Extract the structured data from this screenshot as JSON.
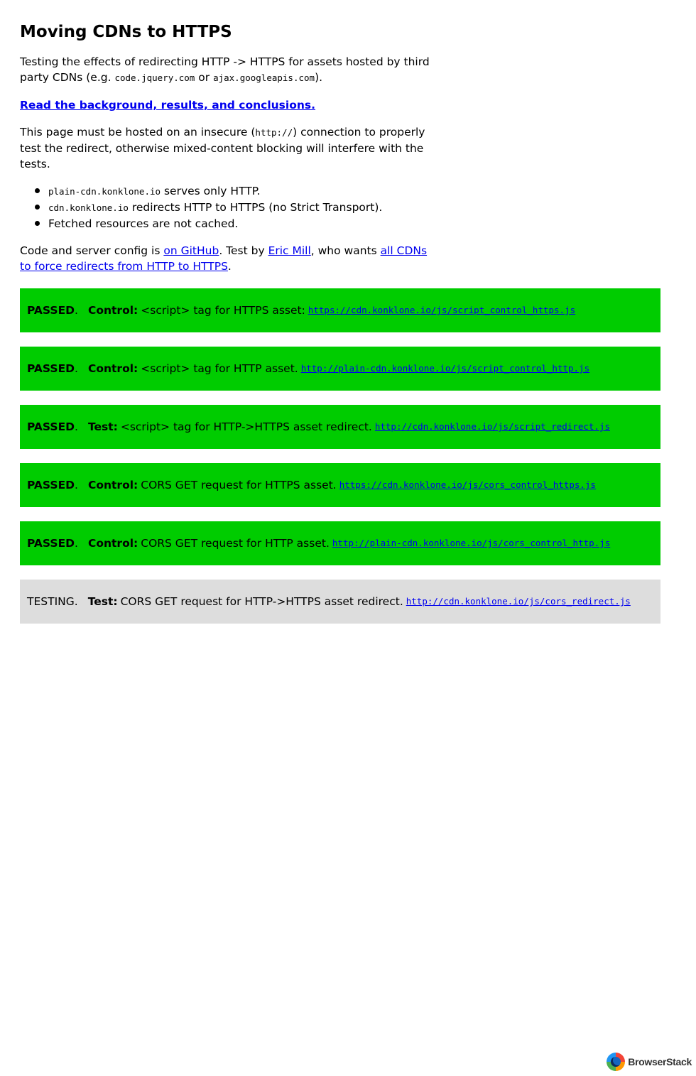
{
  "page": {
    "title": "Moving CDNs to HTTPS",
    "intro": {
      "text1": "Testing the effects of redirecting HTTP -> HTTPS for assets hosted by third party CDNs (e.g. ",
      "code1": "code.jquery.com",
      "text2": " or ",
      "code2": "ajax.googleapis.com",
      "text3": ")."
    },
    "background_link": "Read the background, results, and conclusions.",
    "insecure": {
      "text1": "This page must be hosted on an insecure (",
      "code": "http://",
      "text2": ") connection to properly test the redirect, otherwise mixed-content blocking will interfere with the tests."
    },
    "notes": [
      {
        "code": "plain-cdn.konklone.io",
        "text": " serves only HTTP."
      },
      {
        "code": "cdn.konklone.io",
        "text": " redirects HTTP to HTTPS (no Strict Transport)."
      },
      {
        "code": "",
        "text": "Fetched resources are not cached."
      }
    ],
    "credits": {
      "text1": "Code and server config is ",
      "github_link": "on GitHub",
      "text2": ". Test by ",
      "author_link": "Eric Mill",
      "text3": ", who wants ",
      "cause_link": "all CDNs to force redirects from HTTP to HTTPS",
      "text4": "."
    }
  },
  "tests": [
    {
      "status": "PASSED",
      "kind": "Control:",
      "description": "<script> tag for HTTPS asset:",
      "url": "https://cdn.konklone.io/js/script_control_https.js"
    },
    {
      "status": "PASSED",
      "kind": "Control:",
      "description": "<script> tag for HTTP asset.",
      "url": "http://plain-cdn.konklone.io/js/script_control_http.js"
    },
    {
      "status": "PASSED",
      "kind": "Test:",
      "description": "<script> tag for HTTP->HTTPS asset redirect.",
      "url": "http://cdn.konklone.io/js/script_redirect.js"
    },
    {
      "status": "PASSED",
      "kind": "Control:",
      "description": "CORS GET request for HTTPS asset.",
      "url": "https://cdn.konklone.io/js/cors_control_https.js"
    },
    {
      "status": "PASSED",
      "kind": "Control:",
      "description": "CORS GET request for HTTP asset.",
      "url": "http://plain-cdn.konklone.io/js/cors_control_http.js"
    },
    {
      "status": "TESTING",
      "kind": "Test:",
      "description": "CORS GET request for HTTP->HTTPS asset redirect.",
      "url": "http://cdn.konklone.io/js/cors_redirect.js"
    }
  ],
  "colors": {
    "passed": "#00cc00",
    "testing": "#dddddd",
    "link": "#0000ee"
  },
  "branding": {
    "name": "BrowserStack",
    "icon": "browserstack-logo-icon"
  }
}
